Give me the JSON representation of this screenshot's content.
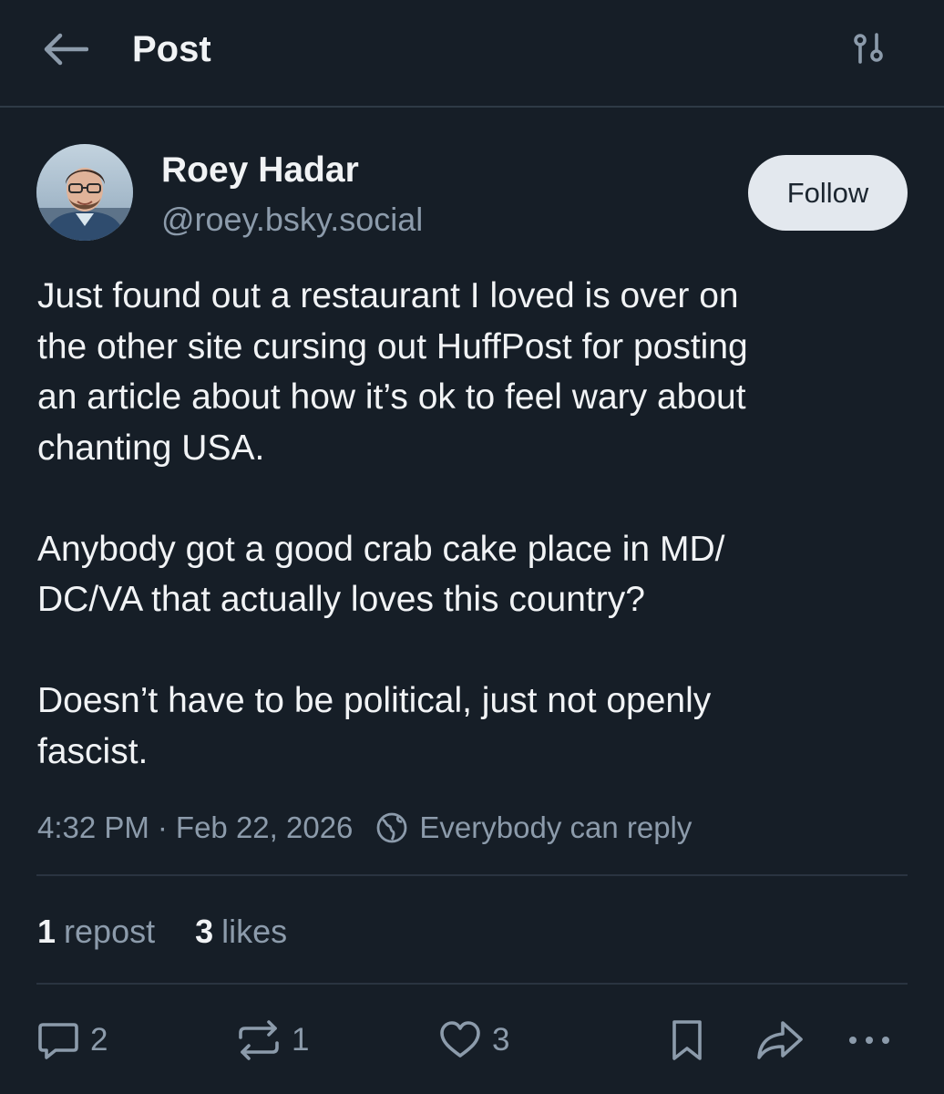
{
  "header": {
    "title": "Post",
    "back_icon": "arrow-left-icon",
    "filter_icon": "sliders-icon"
  },
  "author": {
    "name": "Roey Hadar",
    "handle": "@roey.bsky.social",
    "follow_label": "Follow"
  },
  "post": {
    "paragraphs": [
      "Just found out a restaurant I loved is over on\nthe other site cursing out HuffPost for posting\nan article about how it’s ok to feel wary about\nchanting USA.",
      "Anybody got a good crab cake place in MD/\nDC/VA that actually loves this country?",
      "Doesn’t have to be political, just not openly\nfascist."
    ],
    "time": "4:32 PM",
    "separator": "·",
    "date": "Feb 22, 2026",
    "reply_setting": "Everybody can reply"
  },
  "stats": {
    "reposts_count": "1",
    "reposts_label": "repost",
    "likes_count": "3",
    "likes_label": "likes"
  },
  "actions": {
    "reply_count": "2",
    "repost_count": "1",
    "like_count": "3"
  },
  "colors": {
    "background": "#161e27",
    "text_primary": "#f1f3f5",
    "text_secondary": "#8c9bab",
    "divider": "#2a3440",
    "follow_bg": "#e3e8ee"
  }
}
